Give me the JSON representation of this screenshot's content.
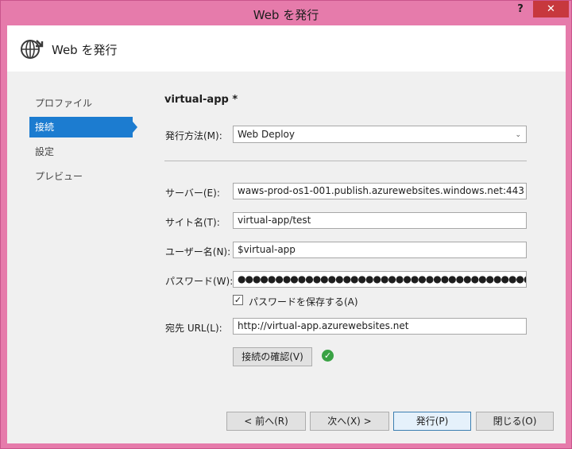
{
  "window": {
    "title": "Web を発行",
    "help_label": "?",
    "close_label": "✕"
  },
  "header": {
    "title": "Web を発行",
    "icon": "globe-publish-icon"
  },
  "sidebar": {
    "items": [
      {
        "label": "プロファイル",
        "active": false
      },
      {
        "label": "接続",
        "active": true
      },
      {
        "label": "設定",
        "active": false
      },
      {
        "label": "プレビュー",
        "active": false
      }
    ]
  },
  "main": {
    "profile_name": "virtual-app *",
    "publish_method": {
      "label": "発行方法(M):",
      "value": "Web Deploy"
    },
    "server": {
      "label": "サーバー(E):",
      "value": "waws-prod-os1-001.publish.azurewebsites.windows.net:443"
    },
    "site_name": {
      "label": "サイト名(T):",
      "value": "virtual-app/test"
    },
    "user_name": {
      "label": "ユーザー名(N):",
      "value": "$virtual-app"
    },
    "password": {
      "label": "パスワード(W):",
      "value": "●●●●●●●●●●●●●●●●●●●●●●●●●●●●●●●●●●●●●●●●●●●●●"
    },
    "save_password": {
      "label": "パスワードを保存する(A)",
      "checked": true
    },
    "destination_url": {
      "label": "宛先 URL(L):",
      "value": "http://virtual-app.azurewebsites.net"
    },
    "validate_button": "接続の確認(V)",
    "validation_status": "success"
  },
  "footer": {
    "prev": "< 前へ(R)",
    "next": "次へ(X) >",
    "publish": "発行(P)",
    "close": "閉じる(O)"
  },
  "colors": {
    "window_frame": "#e67bab",
    "sidebar_active": "#1c7cd0",
    "success": "#39a244"
  }
}
